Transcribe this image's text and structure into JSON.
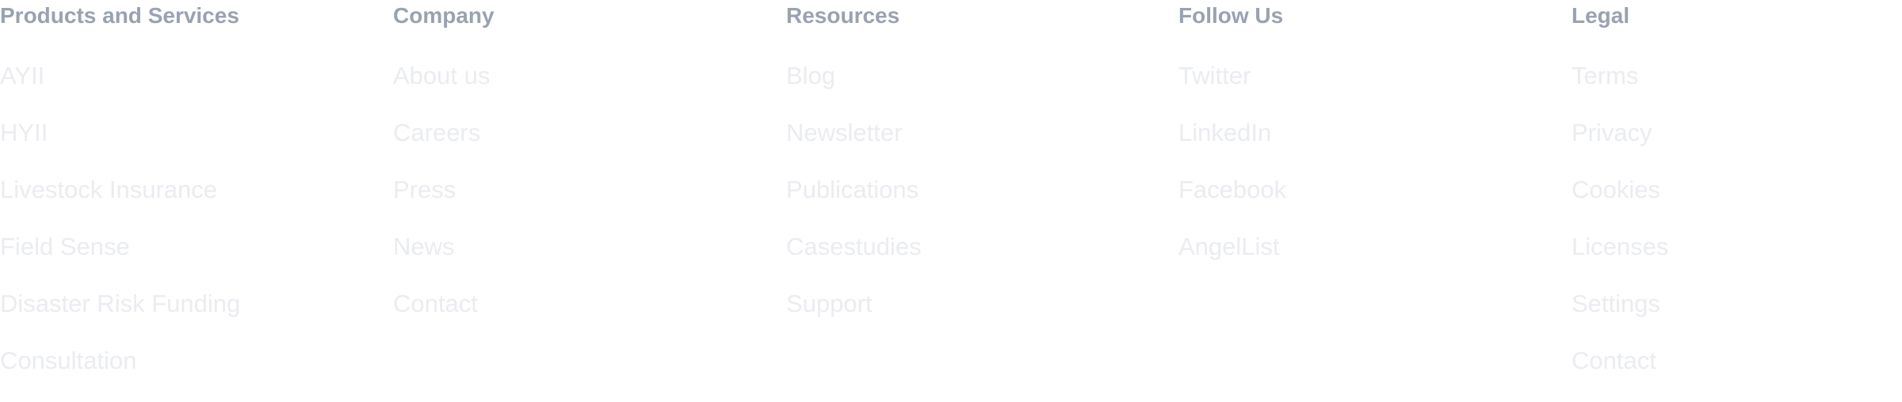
{
  "footer": {
    "columns": [
      {
        "heading": "Products and Services",
        "links": [
          "AYII",
          "HYII",
          "Livestock Insurance",
          "Field Sense",
          "Disaster Risk Funding",
          "Consultation"
        ]
      },
      {
        "heading": "Company",
        "links": [
          "About us",
          "Careers",
          "Press",
          "News",
          "Contact"
        ]
      },
      {
        "heading": "Resources",
        "links": [
          "Blog",
          "Newsletter",
          "Publications",
          "Casestudies",
          "Support"
        ]
      },
      {
        "heading": "Follow Us",
        "links": [
          "Twitter",
          "LinkedIn",
          "Facebook",
          "AngelList"
        ]
      },
      {
        "heading": "Legal",
        "links": [
          "Terms",
          "Privacy",
          "Cookies",
          "Licenses",
          "Settings",
          "Contact"
        ]
      }
    ]
  },
  "colors": {
    "heading": "#98a2b3",
    "link": "#eaecf0",
    "background": "#ffffff"
  }
}
